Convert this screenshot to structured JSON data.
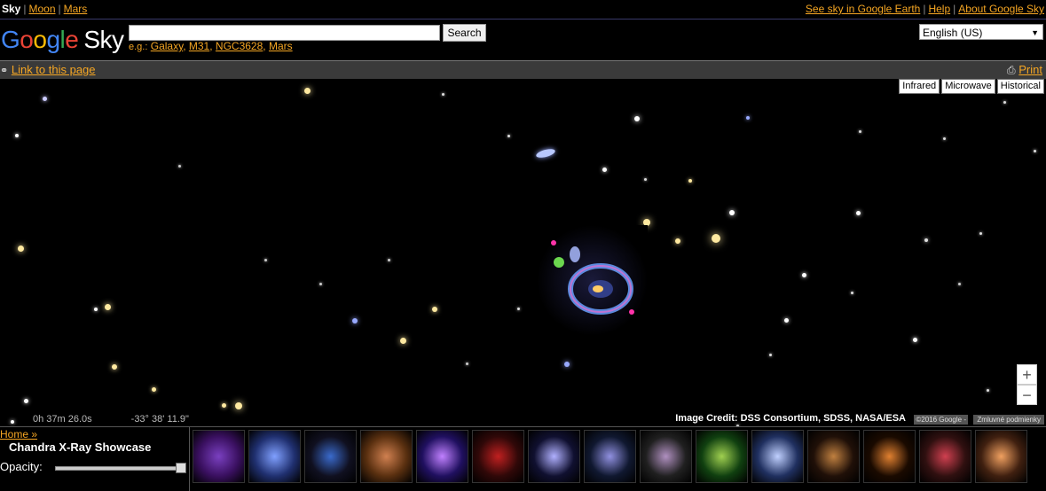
{
  "nav": {
    "sky": "Sky",
    "moon": "Moon",
    "mars": "Mars",
    "earth_link": "See sky in Google Earth",
    "help": "Help",
    "about": "About Google Sky"
  },
  "logo": {
    "g": "G",
    "o1": "o",
    "o2": "o",
    "g2": "g",
    "l": "l",
    "e": "e",
    "product": "Sky"
  },
  "search": {
    "value": "",
    "button": "Search",
    "examples_label": "e.g.:",
    "examples": [
      "Galaxy",
      "M31",
      "NGC3628",
      "Mars"
    ]
  },
  "language": {
    "selected": "English (US)"
  },
  "linkbar": {
    "link_to_page": "Link to this page",
    "print": "Print"
  },
  "layers": [
    "Infrared",
    "Microwave",
    "Historical"
  ],
  "zoom": {
    "in": "+",
    "out": "−"
  },
  "coords": {
    "ra": "0h 37m 26.0s",
    "dec": "-33° 38' 11.9\""
  },
  "credit": "Image Credit: DSS Consortium, SDSS, NASA/ESA",
  "copyright": "©2016 Google -",
  "terms": "Zmluvné podmienky",
  "panel": {
    "home": "Home »",
    "title": "Chandra X-Ray Showcase",
    "opacity_label": "Opacity:",
    "opacity_value": 1.0
  },
  "colors": {
    "link": "#f5a623",
    "background": "#000000"
  }
}
